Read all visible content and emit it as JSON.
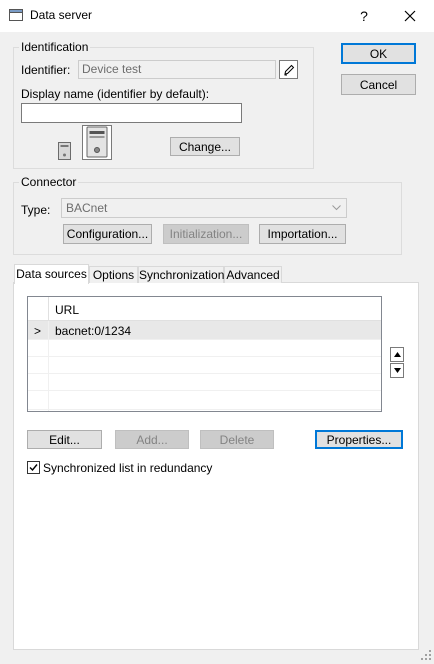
{
  "window": {
    "title": "Data server",
    "help": "?",
    "close": "✕"
  },
  "dialog_buttons": {
    "ok": "OK",
    "cancel": "Cancel"
  },
  "identification": {
    "legend": "Identification",
    "identifier_label": "Identifier:",
    "identifier_value": "Device test",
    "display_name_label": "Display name (identifier by default):",
    "display_name_value": "",
    "change_button": "Change..."
  },
  "connector": {
    "legend": "Connector",
    "type_label": "Type:",
    "type_value": "BACnet",
    "configuration_button": "Configuration...",
    "initialization_button": "Initialization...",
    "importation_button": "Importation..."
  },
  "tabs": [
    {
      "label": "Data sources",
      "active": true
    },
    {
      "label": "Options",
      "active": false
    },
    {
      "label": "Synchronization",
      "active": false
    },
    {
      "label": "Advanced",
      "active": false
    }
  ],
  "data_sources": {
    "column_header": "URL",
    "rows": [
      {
        "marker": ">",
        "url": "bacnet:0/1234"
      }
    ],
    "edit_button": "Edit...",
    "add_button": "Add...",
    "delete_button": "Delete",
    "properties_button": "Properties...",
    "sync_checkbox_label": "Synchronized list in redundancy",
    "sync_checked": true
  }
}
